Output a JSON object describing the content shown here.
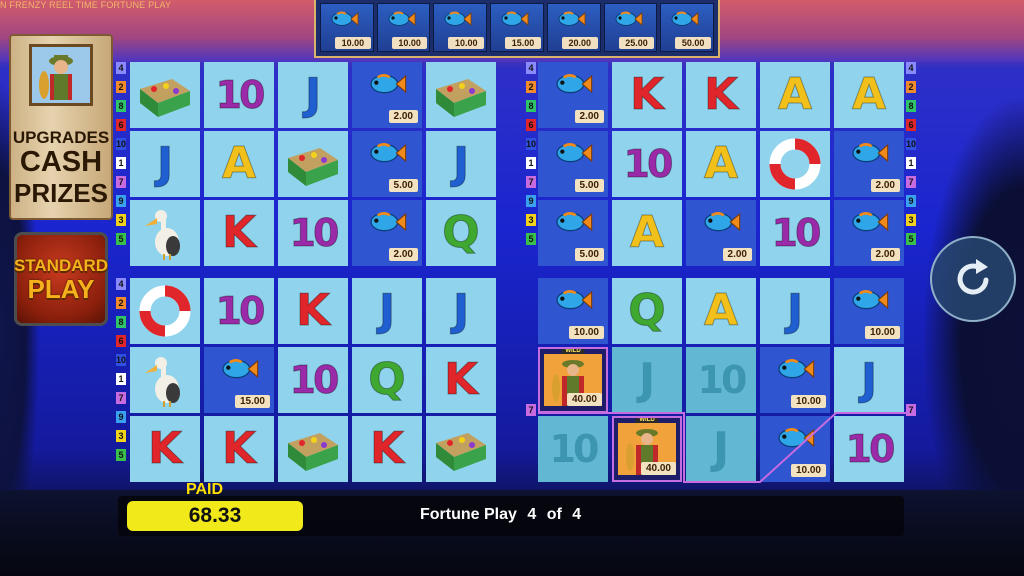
{
  "top_strip_text": "N FRENZY REEL TIME FORTUNE PLAY",
  "fish_values": [
    "10.00",
    "10.00",
    "10.00",
    "15.00",
    "20.00",
    "25.00",
    "50.00"
  ],
  "upgrade_board": {
    "line1": "UPGRADES",
    "line2": "CASH",
    "line3": "PRIZES"
  },
  "standard_play": {
    "line1": "STANDARD",
    "line2": "PLAY"
  },
  "left_numbers_top": [
    "4",
    "2",
    "8",
    "6",
    "10",
    "1",
    "7",
    "9",
    "3",
    "5"
  ],
  "left_numbers_bottom": [
    "4",
    "2",
    "8",
    "6",
    "10",
    "1",
    "7",
    "9",
    "3",
    "5"
  ],
  "middle_numbers_top": [
    "4",
    "2",
    "8",
    "6",
    "10",
    "1",
    "7",
    "9",
    "3",
    "5"
  ],
  "right_numbers_top": [
    "4",
    "2",
    "8",
    "6",
    "10",
    "1",
    "7",
    "9",
    "3",
    "5"
  ],
  "middle_number_bottom": "7",
  "right_number_bottom": "7",
  "grids": {
    "top_left": [
      [
        {
          "s": "box"
        },
        {
          "s": "10"
        },
        {
          "s": "J"
        },
        {
          "s": "fish",
          "v": "2.00",
          "b": true
        },
        {
          "s": "box"
        }
      ],
      [
        {
          "s": "J"
        },
        {
          "s": "A"
        },
        {
          "s": "box"
        },
        {
          "s": "fish",
          "v": "5.00",
          "b": true
        },
        {
          "s": "J"
        }
      ],
      [
        {
          "s": "pelican"
        },
        {
          "s": "K"
        },
        {
          "s": "10"
        },
        {
          "s": "fish",
          "v": "2.00",
          "b": true
        },
        {
          "s": "Q"
        }
      ]
    ],
    "top_right": [
      [
        {
          "s": "fish",
          "v": "2.00",
          "b": true
        },
        {
          "s": "K"
        },
        {
          "s": "K"
        },
        {
          "s": "A"
        },
        {
          "s": "A"
        }
      ],
      [
        {
          "s": "fish",
          "v": "5.00",
          "b": true
        },
        {
          "s": "10"
        },
        {
          "s": "A"
        },
        {
          "s": "ring"
        },
        {
          "s": "fish",
          "v": "2.00",
          "b": true
        }
      ],
      [
        {
          "s": "fish",
          "v": "5.00",
          "b": true
        },
        {
          "s": "A"
        },
        {
          "s": "fish",
          "v": "2.00",
          "b": true
        },
        {
          "s": "10"
        },
        {
          "s": "fish",
          "v": "2.00",
          "b": true
        }
      ]
    ],
    "bottom_left": [
      [
        {
          "s": "ring"
        },
        {
          "s": "10"
        },
        {
          "s": "K"
        },
        {
          "s": "J"
        },
        {
          "s": "J"
        }
      ],
      [
        {
          "s": "pelican"
        },
        {
          "s": "fish",
          "v": "15.00",
          "b": true
        },
        {
          "s": "10"
        },
        {
          "s": "Q"
        },
        {
          "s": "K"
        }
      ],
      [
        {
          "s": "K"
        },
        {
          "s": "K"
        },
        {
          "s": "box"
        },
        {
          "s": "K"
        },
        {
          "s": "box"
        }
      ]
    ],
    "bottom_right": [
      [
        {
          "s": "fish",
          "v": "10.00",
          "b": true
        },
        {
          "s": "Q"
        },
        {
          "s": "A"
        },
        {
          "s": "J"
        },
        {
          "s": "fish",
          "v": "10.00",
          "b": true
        }
      ],
      [
        {
          "s": "wild",
          "v": "40.00"
        },
        {
          "s": "J",
          "d": true
        },
        {
          "s": "10",
          "d": true
        },
        {
          "s": "fish",
          "v": "10.00",
          "b": true
        },
        {
          "s": "J"
        }
      ],
      [
        {
          "s": "10",
          "d": true
        },
        {
          "s": "wild",
          "v": "40.00"
        },
        {
          "s": "J",
          "d": true
        },
        {
          "s": "fish",
          "v": "10.00",
          "b": true
        },
        {
          "s": "10"
        }
      ]
    ]
  },
  "wild_label": "WILD",
  "paid": {
    "label": "PAID",
    "value": "68.33"
  },
  "fortune": {
    "label": "Fortune Play",
    "current": "4",
    "of": "of",
    "total": "4"
  },
  "colors": {
    "paid_box": "#f2e91a",
    "paid_label": "#ffe000",
    "fish_value_bg": "#f2e2bf",
    "cell_light": "#8fd4ec",
    "cell_blue": "#2f55d1"
  },
  "icons": {
    "refresh": "refresh-icon"
  }
}
